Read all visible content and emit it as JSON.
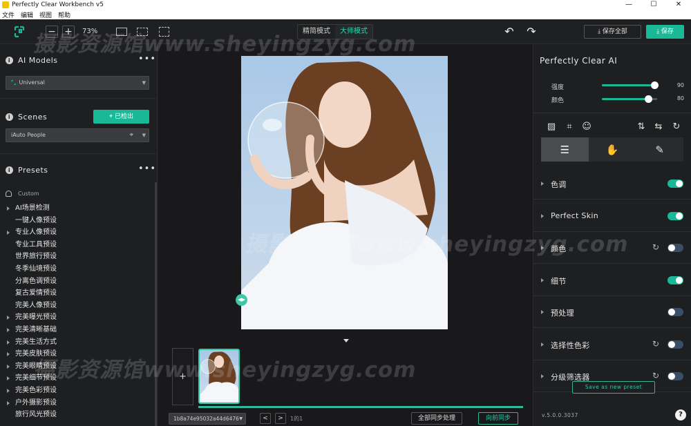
{
  "window": {
    "title": "Perfectly Clear Workbench v5",
    "controls": [
      "—",
      "☐",
      "✕"
    ]
  },
  "menu": [
    "文件",
    "编辑",
    "视图",
    "帮助"
  ],
  "toolbar": {
    "zoom_minus": "−",
    "zoom_plus": "+",
    "zoom_level": "73%",
    "mode_simple": "精简模式",
    "mode_master": "大师模式",
    "save_all": "保存全部",
    "save": "保存"
  },
  "left": {
    "ai_models_title": "AI Models",
    "ai_model_selected": "Universal",
    "scenes_title": "Scenes",
    "detect_button": "已检出",
    "scene_selected": "iAuto People",
    "presets_title": "Presets",
    "preset_user": "Custom",
    "presets": [
      {
        "label": "AI场景检测",
        "arrow": true
      },
      {
        "label": "一键人像预设",
        "arrow": false
      },
      {
        "label": "专业人像预设",
        "arrow": true
      },
      {
        "label": "专业工具预设",
        "arrow": false
      },
      {
        "label": "世界旅行预设",
        "arrow": false
      },
      {
        "label": "冬季仙境预设",
        "arrow": false
      },
      {
        "label": "分离色调预设",
        "arrow": false
      },
      {
        "label": "复古爱情预设",
        "arrow": false
      },
      {
        "label": "完美人像预设",
        "arrow": false
      },
      {
        "label": "完美曝光预设",
        "arrow": true
      },
      {
        "label": "完美清晰基础",
        "arrow": true
      },
      {
        "label": "完美生活方式",
        "arrow": true
      },
      {
        "label": "完美皮肤预设",
        "arrow": true
      },
      {
        "label": "完美眼睛预设",
        "arrow": true
      },
      {
        "label": "完美细节预设",
        "arrow": true
      },
      {
        "label": "完美色彩预设",
        "arrow": true
      },
      {
        "label": "户外摄影预设",
        "arrow": true
      },
      {
        "label": "旅行风光预设",
        "arrow": false
      }
    ]
  },
  "center": {
    "file_id": "1b8a74e95032a44d6476",
    "page_count": "1的1",
    "sync_all": "全部同步处理",
    "sync_forward": "向前同步",
    "add": "+"
  },
  "right": {
    "title": "Perfectly Clear AI",
    "sliders": [
      {
        "label": "强度",
        "value": "90",
        "fraction": 0.95
      },
      {
        "label": "颜色",
        "value": "80",
        "fraction": 0.84
      }
    ],
    "adjustments": [
      {
        "label": "色调",
        "toggle": "on",
        "reset": false
      },
      {
        "label": "Perfect Skin",
        "toggle": "on",
        "reset": false
      },
      {
        "label": "颜色",
        "toggle": "off",
        "reset": true
      },
      {
        "label": "细节",
        "toggle": "on",
        "reset": false
      },
      {
        "label": "预处理",
        "toggle": "off",
        "reset": false
      },
      {
        "label": "选择性色彩",
        "toggle": "off",
        "reset": true
      },
      {
        "label": "分级筛选器",
        "toggle": "off",
        "reset": true
      }
    ],
    "save_preset": "Save as new preset",
    "version": "v.5.0.0.3037",
    "help": "?"
  },
  "watermark": "摄影资源馆www.sheyingzyg.com",
  "colors": {
    "accent": "#19b896",
    "bg": "#1b1c1e",
    "panel": "#1e1f21"
  }
}
